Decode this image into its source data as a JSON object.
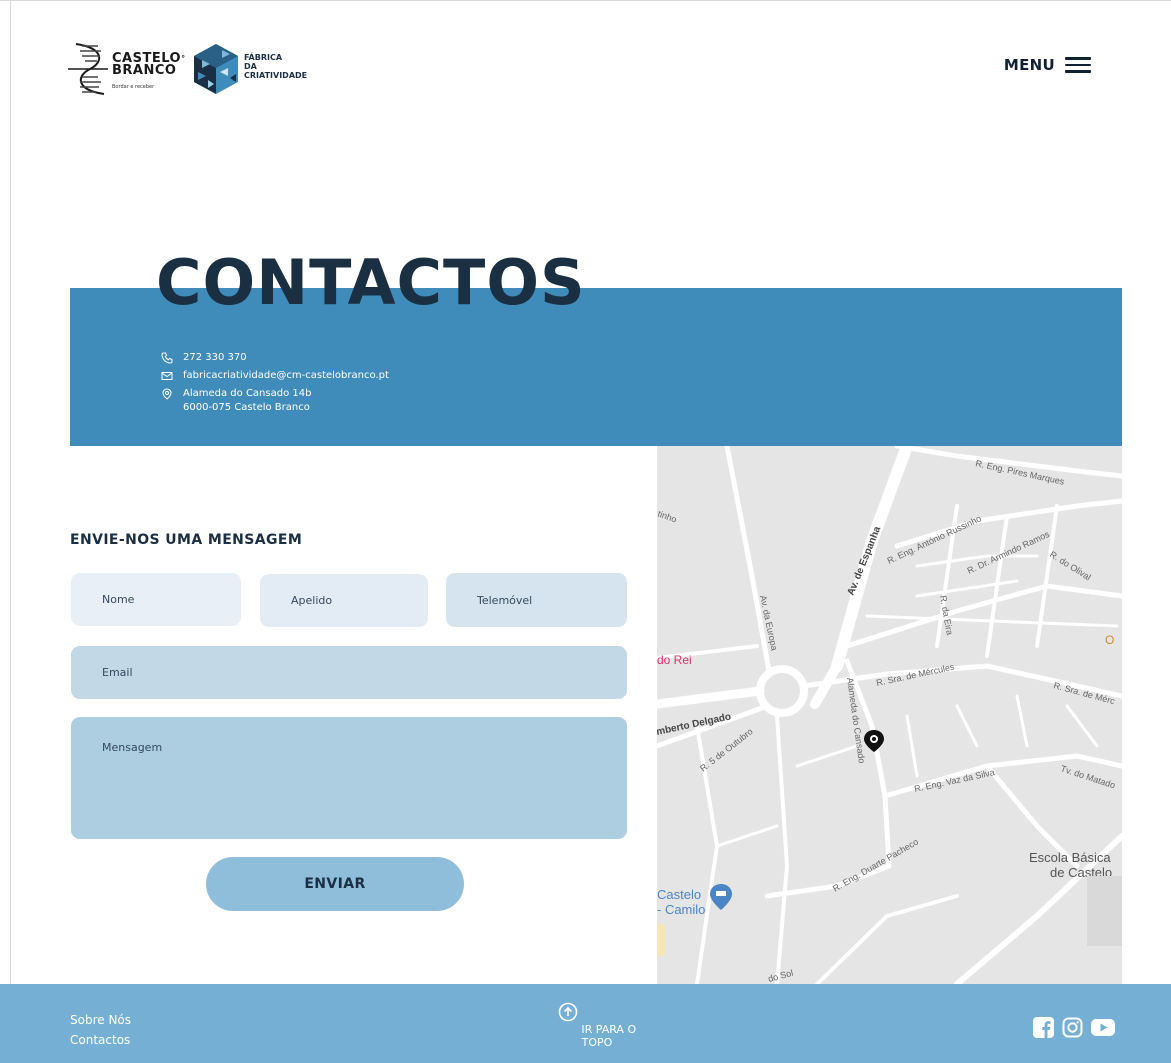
{
  "header": {
    "logo_castelo_line1": "CASTELO",
    "logo_castelo_line2": "BRANCO",
    "logo_castelo_tagline": "Bordar e receber",
    "logo_fabrica_line1": "FÁBRICA",
    "logo_fabrica_line2": "DA",
    "logo_fabrica_line3": "CRIATIVIDADE",
    "menu_label": "MENU"
  },
  "contacts": {
    "title": "CONTACTOS",
    "phone": "272 330 370",
    "email": "fabricacriatividade@cm-castelobranco.pt",
    "address_line1": "Alameda do Cansado 14b",
    "address_line2": "6000-075 Castelo Branco"
  },
  "form": {
    "title": "ENVIE-NOS UMA MENSAGEM",
    "name_placeholder": "Nome",
    "surname_placeholder": "Apelido",
    "phone_placeholder": "Telemóvel",
    "email_placeholder": "Email",
    "message_placeholder": "Mensagem",
    "submit_label": "ENVIAR"
  },
  "map": {
    "labels": {
      "pires_marques": "R. Eng. Pires Marques",
      "av_espanha": "Av. de Espanha",
      "antonio_russinho": "R. Eng. António Russinho",
      "armindo_ramos": "R. Dr. Armindo Ramos",
      "olival": "R. do Olival",
      "eira": "R. da Eira",
      "av_europa": "Av. da Europa",
      "do_rei": "do Rei",
      "sra_mercules": "R. Sra. de Mércules",
      "sra_merc_right": "R. Sra. de Mérc",
      "alameda_cansado": "Alameda do Cansado",
      "delgado": "mberto Delgado",
      "cinco_outubro": "R. 5 de Outubro",
      "vaz_silva": "R. Eng. Vaz da Silva",
      "matadouro": "Tv. do Matado",
      "duarte_pacheco": "R. Eng. Duarte Pacheco",
      "escola_l1": "Escola Básica",
      "escola_l2": "de Castelo",
      "castelo_camilo_l1": "Castelo",
      "castelo_camilo_l2": "- Camilo",
      "do_sol": "do Sol",
      "fragment_o": "O",
      "fragment_tinho": "tinho"
    },
    "colors": {
      "road": "#ffffff",
      "land": "#e5e5e5",
      "pin": "#111111",
      "poi_pink": "#d6336c",
      "poi_blue": "#4a86c5"
    }
  },
  "footer": {
    "link_about": "Sobre Nós",
    "link_contacts": "Contactos",
    "to_top_label": "IR PARA O TOPO",
    "social": [
      "facebook-icon",
      "instagram-icon",
      "youtube-icon"
    ]
  },
  "colors": {
    "banner": "#3f8bba",
    "title": "#1a2f42",
    "footer": "#75b0d4",
    "button": "#8fbedb"
  }
}
